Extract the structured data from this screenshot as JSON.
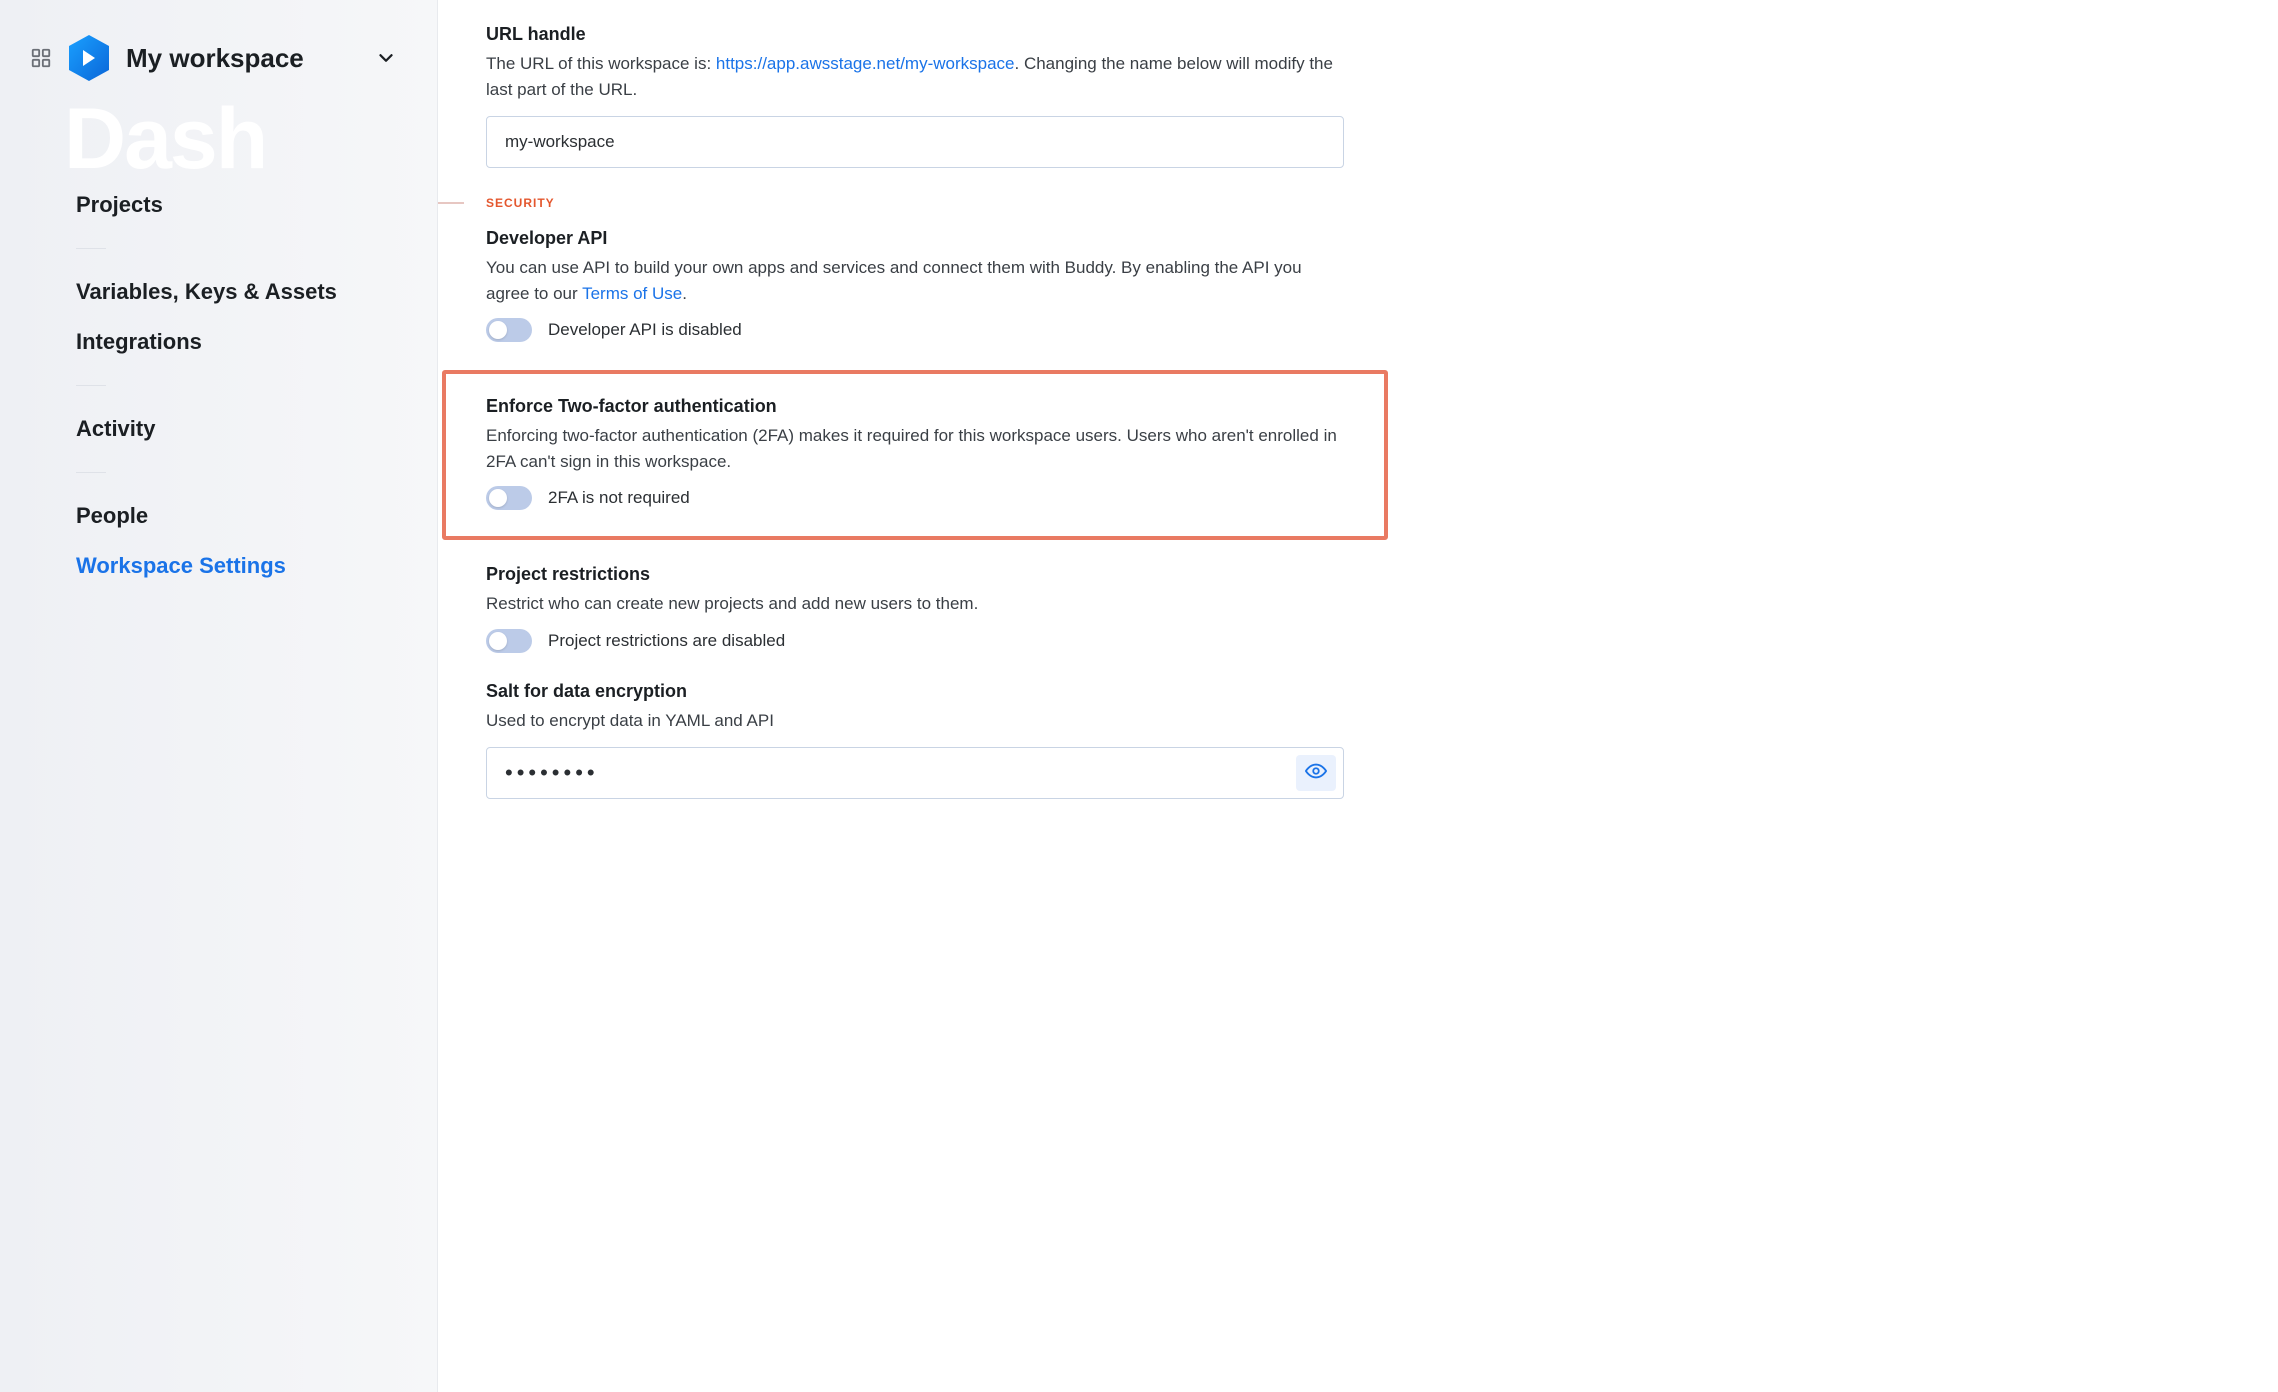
{
  "sidebar": {
    "workspace_title": "My workspace",
    "watermark": "Dash",
    "nav": {
      "projects": "Projects",
      "variables": "Variables, Keys & Assets",
      "integrations": "Integrations",
      "activity": "Activity",
      "people": "People",
      "workspace_settings": "Workspace Settings"
    }
  },
  "main": {
    "url_handle": {
      "title": "URL handle",
      "desc_prefix": "The URL of this workspace is: ",
      "url": "https://app.awsstage.net/my-workspace",
      "desc_suffix": ". Changing the name below will modify the last part of the URL.",
      "value": "my-workspace"
    },
    "security_label": "SECURITY",
    "developer_api": {
      "title": "Developer API",
      "desc_prefix": "You can use API to build your own apps and services and connect them with Buddy. By enabling the API you agree to our ",
      "link_text": "Terms of Use",
      "desc_suffix": ".",
      "toggle_label": "Developer API is disabled"
    },
    "twofa": {
      "title": "Enforce Two-factor authentication",
      "desc": "Enforcing two-factor authentication (2FA) makes it required for this workspace users. Users who aren't enrolled in 2FA can't sign in this workspace.",
      "toggle_label": "2FA is not required"
    },
    "project_restrictions": {
      "title": "Project restrictions",
      "desc": "Restrict who can create new projects and add new users to them.",
      "toggle_label": "Project restrictions are disabled"
    },
    "salt": {
      "title": "Salt for data encryption",
      "desc": "Used to encrypt data in YAML and API",
      "value": "••••••••"
    }
  }
}
